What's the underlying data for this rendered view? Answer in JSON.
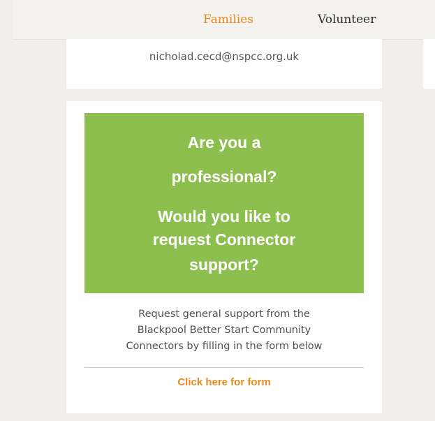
{
  "nav": {
    "families_label": "Families",
    "volunteer_label": "Volunteer"
  },
  "contact": {
    "email": "nicholad.cecd@nspcc.org.uk"
  },
  "professional_card": {
    "banner_lines": [
      "Are you a",
      "professional?",
      "Would you like to",
      "request Connector",
      "support?"
    ],
    "description_lines": [
      "Request general support from the",
      "Blackpool Better Start Community",
      "Connectors by filling in the form below"
    ],
    "form_link_label": "Click here for form"
  },
  "colors": {
    "accent_orange": "#e8891c",
    "banner_green": "#8dbf4e",
    "page_background": "#f0efec"
  }
}
